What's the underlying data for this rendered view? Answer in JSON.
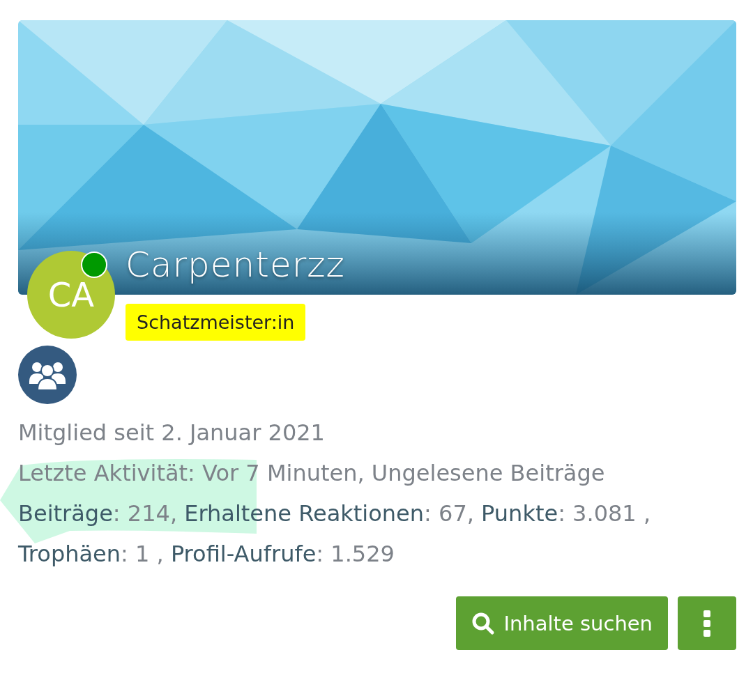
{
  "profile": {
    "username": "Carpenterzz",
    "avatar_initials": "CA",
    "online": true,
    "title_badge": "Schatzmeister:in"
  },
  "member_since": "Mitglied seit 2. Januar 2021",
  "last_activity": "Letzte Aktivität: Vor 7 Minuten,",
  "unread_link": "Ungelesene Beiträge",
  "stats": [
    {
      "label": "Beiträge",
      "value": ": 214,"
    },
    {
      "label": "Erhaltene Reaktionen",
      "value": ": 67,"
    },
    {
      "label": "Punkte",
      "value": ": 3.081 ,"
    },
    {
      "label": "Trophäen",
      "value": ": 1 ,"
    },
    {
      "label": "Profil-Aufrufe",
      "value": ": 1.529"
    }
  ],
  "buttons": {
    "search": "Inhalte suchen"
  }
}
